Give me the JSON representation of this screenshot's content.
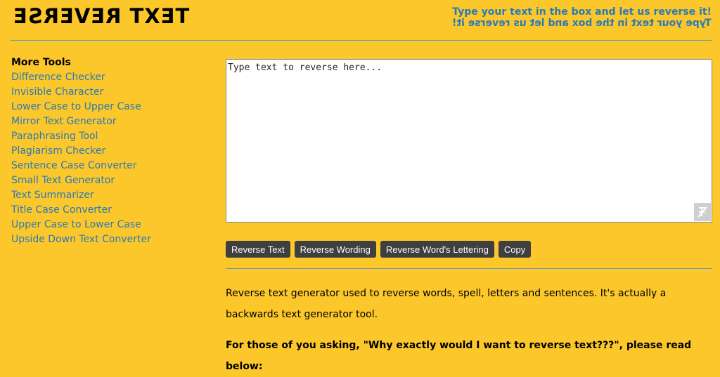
{
  "header": {
    "logo": "TEXT REVERSE",
    "tagline": "Type your text in the box and let us reverse it!",
    "tagline_reversed": "Type your text in the box and let us reverse it!"
  },
  "sidebar": {
    "title": "More Tools",
    "items": [
      {
        "label": "Difference Checker"
      },
      {
        "label": "Invisible Character"
      },
      {
        "label": "Lower Case to Upper Case"
      },
      {
        "label": "Mirror Text Generator"
      },
      {
        "label": "Paraphrasing Tool"
      },
      {
        "label": "Plagiarism Checker"
      },
      {
        "label": "Sentence Case Converter"
      },
      {
        "label": "Small Text Generator"
      },
      {
        "label": "Text Summarizer"
      },
      {
        "label": "Title Case Converter"
      },
      {
        "label": "Upper Case to Lower Case"
      },
      {
        "label": "Upside Down Text Converter"
      }
    ]
  },
  "editor": {
    "placeholder": "Type text to reverse here...",
    "value": ""
  },
  "buttons": {
    "reverse_text": "Reverse Text",
    "reverse_wording": "Reverse Wording",
    "reverse_lettering": "Reverse Word's Lettering",
    "copy": "Copy"
  },
  "content": {
    "description": "Reverse text generator used to reverse words, spell, letters and sentences. It's actually a backwards text generator tool.",
    "question": "For those of you asking, \"Why exactly would I want to reverse text???\", please read below:"
  },
  "colors": {
    "background": "#fcc72a",
    "link": "#2a7ab8",
    "button": "#3f3f3f"
  }
}
